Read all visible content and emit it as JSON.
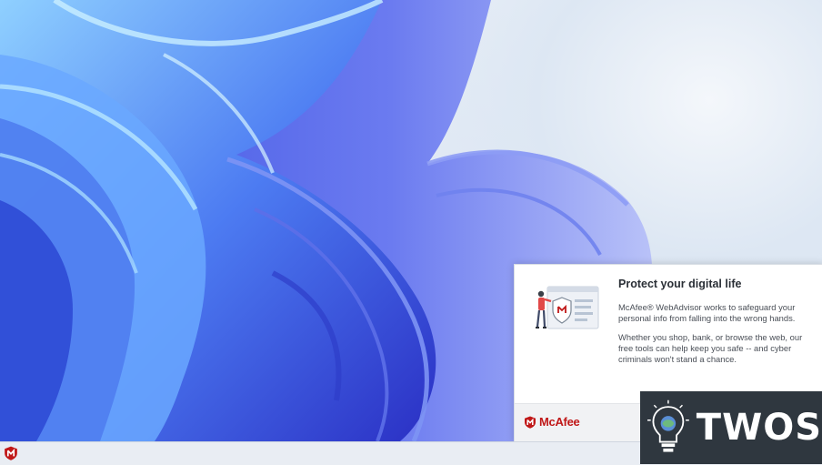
{
  "desktop": {
    "wallpaper": "windows-11-bloom-wallpaper",
    "accent_color": "#3f57e0"
  },
  "popup": {
    "title": "Protect your digital life",
    "paragraph1": "McAfee® WebAdvisor works to safeguard your personal info from falling into the wrong hands.",
    "paragraph2": "Whether you shop, bank, or browse the web, our free tools can help keep you safe -- and cyber criminals won't stand a chance.",
    "illustration": "person-with-shield-illustration",
    "brand_name": "McAfee",
    "brand_color": "#c01818"
  },
  "taskbar": {
    "icon": "mcafee-shield-icon"
  },
  "watermark": {
    "text": "TWOS",
    "icon": "lightbulb-icon"
  }
}
